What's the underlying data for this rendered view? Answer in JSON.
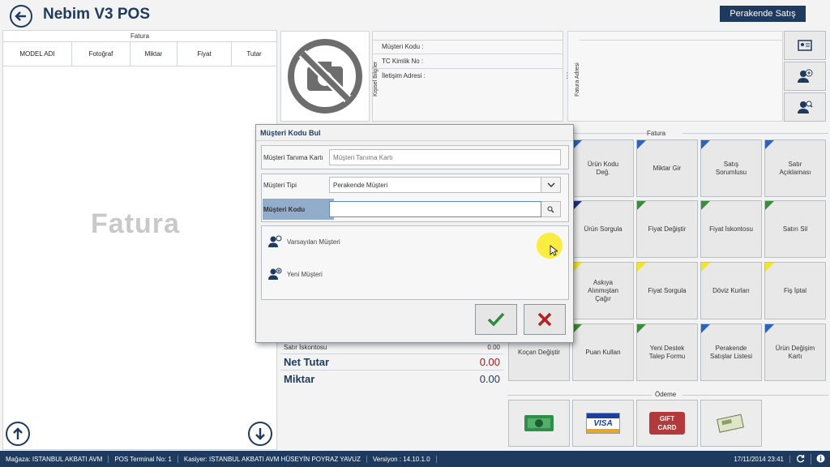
{
  "app": {
    "title": "Nebim V3 POS",
    "mode_button": "Perakende Satış"
  },
  "invoice": {
    "caption": "Fatura",
    "columns": [
      "MODEL ADI",
      "Fotoğraf",
      "Miktar",
      "Fiyat",
      "Tutar"
    ],
    "watermark": "Fatura"
  },
  "customer": {
    "section_label": "Kişisel Bilgiler",
    "address_label": "Fatura Adresi",
    "fields": {
      "code": "Müşteri Kodu   :",
      "tc": "TC Kimlik No   :",
      "address": "İletişim Adresi   :"
    }
  },
  "fatura_grid": {
    "label": "Fatura",
    "tiles": [
      {
        "label": "Ürün Kodu Değ.",
        "color": "#2a63c4"
      },
      {
        "label": "Miktar Gir",
        "color": "#2a63c4"
      },
      {
        "label": "Satış Sorumlusu",
        "color": "#2a63c4"
      },
      {
        "label": "Satır Açıklaması",
        "color": "#2a63c4"
      },
      {
        "label": "Ürün Sorgula",
        "color": "#1f2f7a"
      },
      {
        "label": "Fiyat Değiştir",
        "color": "#3c8c3c"
      },
      {
        "label": "Fiyat İskontosu",
        "color": "#3c8c3c"
      },
      {
        "label": "Satırı Sil",
        "color": "#3c8c3c"
      },
      {
        "label": "Askıya Alınmıştan Çağır",
        "color": "#f2e61c"
      },
      {
        "label": "Fiyat Sorgula",
        "color": "#f2e61c"
      },
      {
        "label": "Döviz Kurları",
        "color": "#f2e61c"
      },
      {
        "label": "Fiş İptal",
        "color": "#f2e61c"
      },
      {
        "label": "Koçan Değiştir",
        "color": "#2a63c4"
      },
      {
        "label": "Puan Kullan",
        "color": "#3c8c3c"
      },
      {
        "label": "Yeni Destek Talep Formu",
        "color": "#3c8c3c"
      },
      {
        "label": "Perakende Satışlar Listesi",
        "color": "#2a63c4"
      },
      {
        "label": "Ürün Değişim Kartı",
        "color": "#2a63c4"
      }
    ]
  },
  "totals": {
    "satir_iskontosu": {
      "label": "Satır İskontosu",
      "value": "0.00"
    },
    "net_tutar": {
      "label": "Net Tutar",
      "value": "0.00"
    },
    "miktar": {
      "label": "Miktar",
      "value": "0.00"
    }
  },
  "odeme": {
    "label": "Ödeme",
    "visa": "VISA",
    "gift": "GIFT",
    "card": "CARD"
  },
  "dialog": {
    "title": "Müşteri Kodu Bul",
    "tanima_karti": {
      "label": "Müşteri Tanıma Kartı",
      "placeholder": "Müşteri Tanıma Kartı"
    },
    "musteri_tipi": {
      "label": "Müşteri Tipi",
      "value": "Perakende Müşteri"
    },
    "musteri_kodu": {
      "label": "Müşteri Kodu",
      "value": ""
    },
    "options": {
      "default": "Varsayılan Müşteri",
      "new": "Yeni Müşteri"
    }
  },
  "status": {
    "magaza": "Mağaza: ISTANBUL AKBATI AVM",
    "terminal": "POS Terminal No: 1",
    "kasiyer": "Kasiyer: ISTANBUL AKBATI AVM HÜSEYİN POYRAZ YAVUZ",
    "versiyon": "Versiyon : 14.10.1.0",
    "datetime": "17/11/2014 23:41"
  }
}
